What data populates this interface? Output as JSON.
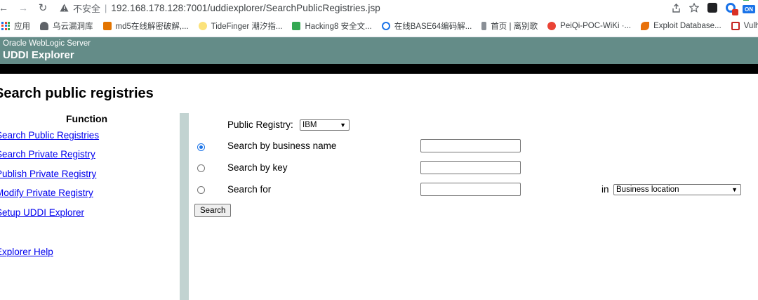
{
  "browser": {
    "nav": {
      "back": "←",
      "forward": "→",
      "reload": "↻"
    },
    "security_label": "不安全",
    "separator": "|",
    "url": "192.168.178.128:7001/uddiexplorer/SearchPublicRegistries.jsp",
    "right_icons": [
      "share-icon",
      "star-icon",
      "extension-icon",
      "extension-icon",
      "extension-icon"
    ],
    "ext_on_label": "ON"
  },
  "bookmarks": [
    {
      "label": "应用",
      "icon": "apps-grid-icon",
      "color": "#1a73e8"
    },
    {
      "label": "乌云漏洞库",
      "icon": "cloud-icon",
      "color": "#5f6368"
    },
    {
      "label": "md5在线解密破解,...",
      "icon": "md5-icon",
      "color": "#e37400"
    },
    {
      "label": "TideFinger 潮汐指...",
      "icon": "bulb-icon",
      "color": "#fbbc04"
    },
    {
      "label": "Hacking8 安全文...",
      "icon": "h-icon",
      "color": "#34a853"
    },
    {
      "label": "在线BASE64编码解...",
      "icon": "code-icon",
      "color": "#1a73e8"
    },
    {
      "label": "首页 | 离别歌",
      "icon": "pin-icon",
      "color": "#5f6368"
    },
    {
      "label": "PeiQi-POC-WiKi ·...",
      "icon": "peiqi-icon",
      "color": "#ea4335"
    },
    {
      "label": "Exploit Database...",
      "icon": "exploit-icon",
      "color": "#e8710a"
    },
    {
      "label": "Vulhub - Docker-...",
      "icon": "vulhub-icon",
      "color": "#c5221f"
    }
  ],
  "header": {
    "subtitle": "Oracle WebLogic Server",
    "title": "UDDI Explorer",
    "bg_color": "#648c88"
  },
  "page": {
    "heading": "Search public registries"
  },
  "function_panel": {
    "title": "Function",
    "links": [
      "Search Public Registries",
      "Search Private Registry",
      "Publish Private Registry",
      "Modify Private Registry",
      "Setup UDDI Explorer",
      "Explorer Help"
    ],
    "link_color": "#0000ee"
  },
  "search_form": {
    "registry_label": "Public Registry:",
    "registry_value": "IBM",
    "options": [
      {
        "label": "Search by business name",
        "checked": true,
        "value": ""
      },
      {
        "label": "Search by key",
        "checked": false,
        "value": ""
      },
      {
        "label": "Search for",
        "checked": false,
        "value": ""
      }
    ],
    "in_label": "in",
    "in_select_value": "Business location",
    "submit_label": "Search"
  },
  "colors": {
    "divider": "#c2d3d1",
    "accent": "#1a73e8"
  }
}
